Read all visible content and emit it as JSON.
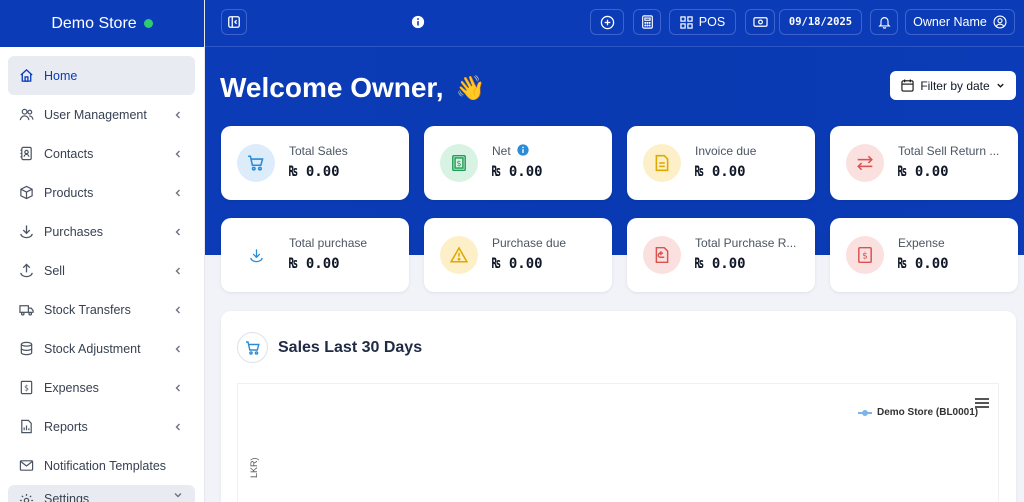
{
  "brand": {
    "name": "Demo Store",
    "status_color": "#2ecc71"
  },
  "sidebar": {
    "items": [
      {
        "label": "Home",
        "icon": "home-icon",
        "active": true,
        "chevron": false
      },
      {
        "label": "User Management",
        "icon": "users-icon",
        "chevron": true
      },
      {
        "label": "Contacts",
        "icon": "contacts-icon",
        "chevron": true
      },
      {
        "label": "Products",
        "icon": "box-icon",
        "chevron": true
      },
      {
        "label": "Purchases",
        "icon": "download-icon",
        "chevron": true
      },
      {
        "label": "Sell",
        "icon": "upload-icon",
        "chevron": true
      },
      {
        "label": "Stock Transfers",
        "icon": "truck-icon",
        "chevron": true
      },
      {
        "label": "Stock Adjustment",
        "icon": "database-icon",
        "chevron": true
      },
      {
        "label": "Expenses",
        "icon": "receipt-icon",
        "chevron": true
      },
      {
        "label": "Reports",
        "icon": "report-icon",
        "chevron": true
      },
      {
        "label": "Notification Templates",
        "icon": "mail-icon",
        "chevron": false
      },
      {
        "label": "Settings",
        "icon": "gear-icon",
        "chevron": true
      }
    ]
  },
  "topbar": {
    "pos_label": "POS",
    "date": "09/18/2025",
    "user_name": "Owner Name"
  },
  "main": {
    "welcome": "Welcome Owner,",
    "welcome_emoji": "👋",
    "filter_label": "Filter by date"
  },
  "cards": [
    {
      "label": "Total Sales",
      "value": "₨ 0.00",
      "icon": "cart-icon",
      "bg": "#dcecfb",
      "fg": "#2a8bd6"
    },
    {
      "label": "Net",
      "value": "₨ 0.00",
      "icon": "money-icon",
      "bg": "#d8f3e3",
      "fg": "#1f9d55",
      "info": true
    },
    {
      "label": "Invoice due",
      "value": "₨ 0.00",
      "icon": "file-icon",
      "bg": "#fdf0c8",
      "fg": "#e0a800"
    },
    {
      "label": "Total Sell Return ...",
      "value": "₨ 0.00",
      "icon": "swap-icon",
      "bg": "#fbe0e0",
      "fg": "#d9534f"
    },
    {
      "label": "Total purchase",
      "value": "₨ 0.00",
      "icon": "download-icon",
      "bg": "#ffffff",
      "fg": "#2a8bd6"
    },
    {
      "label": "Purchase due",
      "value": "₨ 0.00",
      "icon": "warning-icon",
      "bg": "#fdf0c8",
      "fg": "#e0a800"
    },
    {
      "label": "Total Purchase R...",
      "value": "₨ 0.00",
      "icon": "return-doc-icon",
      "bg": "#fbe0e0",
      "fg": "#d9534f"
    },
    {
      "label": "Expense",
      "value": "₨ 0.00",
      "icon": "dollar-doc-icon",
      "bg": "#fbe0e0",
      "fg": "#d9534f"
    }
  ],
  "sales_panel": {
    "title": "Sales Last 30 Days",
    "legend": "Demo Store (BL0001)",
    "ylabel_fragment": "LKR)"
  }
}
